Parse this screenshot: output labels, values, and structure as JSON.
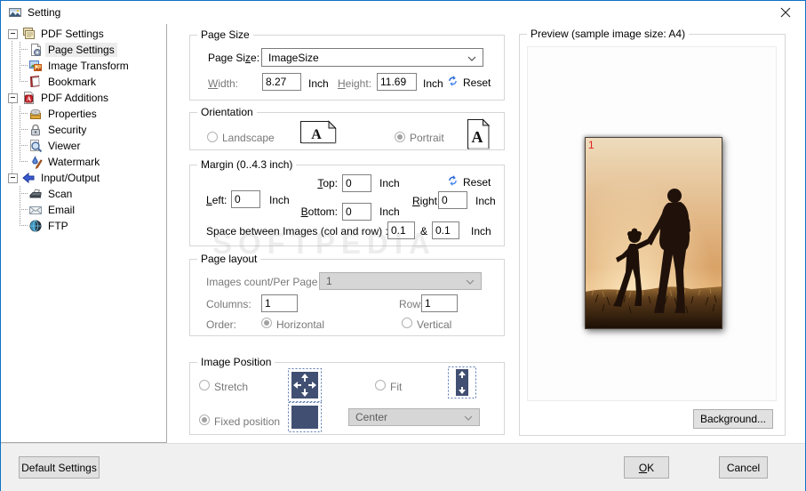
{
  "window": {
    "title": "Setting"
  },
  "tree": {
    "items": [
      {
        "id": "pdf-settings",
        "label": "PDF Settings",
        "level": 0,
        "icon": "documents-icon",
        "expanded": true
      },
      {
        "id": "page-settings",
        "label": "Page Settings",
        "level": 1,
        "icon": "page-gear-icon",
        "selected": true
      },
      {
        "id": "image-transform",
        "label": "Image Transform",
        "level": 1,
        "icon": "images-icon"
      },
      {
        "id": "bookmark",
        "label": "Bookmark",
        "level": 1,
        "icon": "book-icon"
      },
      {
        "id": "pdf-additions",
        "label": "PDF Additions",
        "level": 0,
        "icon": "pdf-file-icon",
        "expanded": true
      },
      {
        "id": "properties",
        "label": "Properties",
        "level": 1,
        "icon": "properties-icon"
      },
      {
        "id": "security",
        "label": "Security",
        "level": 1,
        "icon": "lock-icon"
      },
      {
        "id": "viewer",
        "label": "Viewer",
        "level": 1,
        "icon": "magnifier-icon"
      },
      {
        "id": "watermark",
        "label": "Watermark",
        "level": 1,
        "icon": "watermark-pen-icon"
      },
      {
        "id": "input-output",
        "label": "Input/Output",
        "level": 0,
        "icon": "arrow-icon",
        "expanded": true
      },
      {
        "id": "scan",
        "label": "Scan",
        "level": 1,
        "icon": "scanner-icon"
      },
      {
        "id": "email",
        "label": "Email",
        "level": 1,
        "icon": "envelope-icon"
      },
      {
        "id": "ftp",
        "label": "FTP",
        "level": 1,
        "icon": "globe-icon"
      }
    ]
  },
  "page_size": {
    "group_label": "Page Size",
    "page_size_label": "Page Size:",
    "page_size_value": "ImageSize",
    "width_label": "Width:",
    "width_value": "8.27",
    "width_unit": "Inch",
    "height_label": "Height:",
    "height_value": "11.69",
    "height_unit": "Inch",
    "reset_label": "Reset"
  },
  "orientation": {
    "group_label": "Orientation",
    "landscape_label": "Landscape",
    "portrait_label": "Portrait",
    "selected": "portrait"
  },
  "margin": {
    "group_label": "Margin (0..4.3 inch)",
    "top_label": "Top:",
    "top_value": "0",
    "bottom_label": "Bottom:",
    "bottom_value": "0",
    "left_label": "Left:",
    "left_value": "0",
    "right_label": "Right:",
    "right_value": "0",
    "unit": "Inch",
    "reset_label": "Reset",
    "space_label": "Space between Images (col and row) :",
    "space_col_value": "0.1",
    "space_amp": "&",
    "space_row_value": "0.1"
  },
  "page_layout": {
    "group_label": "Page layout",
    "images_count_label": "Images count/Per Page",
    "images_count_value": "1",
    "columns_label": "Columns:",
    "columns_value": "1",
    "rows_label": "Rows:",
    "rows_value": "1",
    "order_label": "Order:",
    "horizontal_label": "Horizontal",
    "vertical_label": "Vertical",
    "order_selected": "horizontal"
  },
  "image_position": {
    "group_label": "Image Position",
    "stretch_label": "Stretch",
    "fit_label": "Fit",
    "fixed_label": "Fixed position",
    "position_value": "Center",
    "selected": "fixed"
  },
  "preview": {
    "group_label": "Preview (sample image size: A4)",
    "image_number": "1",
    "background_button": "Background..."
  },
  "footer": {
    "default_button": "Default Settings",
    "ok_button": "OK",
    "cancel_button": "Cancel"
  },
  "watermark": "SOFTPEDIA",
  "colors": {
    "accent": "#0f72c4",
    "navy": "#414f72",
    "dashed": "#5b7ab0",
    "red": "#e32222",
    "reset_blue": "#2e6bd6",
    "selection": "#ececec"
  }
}
